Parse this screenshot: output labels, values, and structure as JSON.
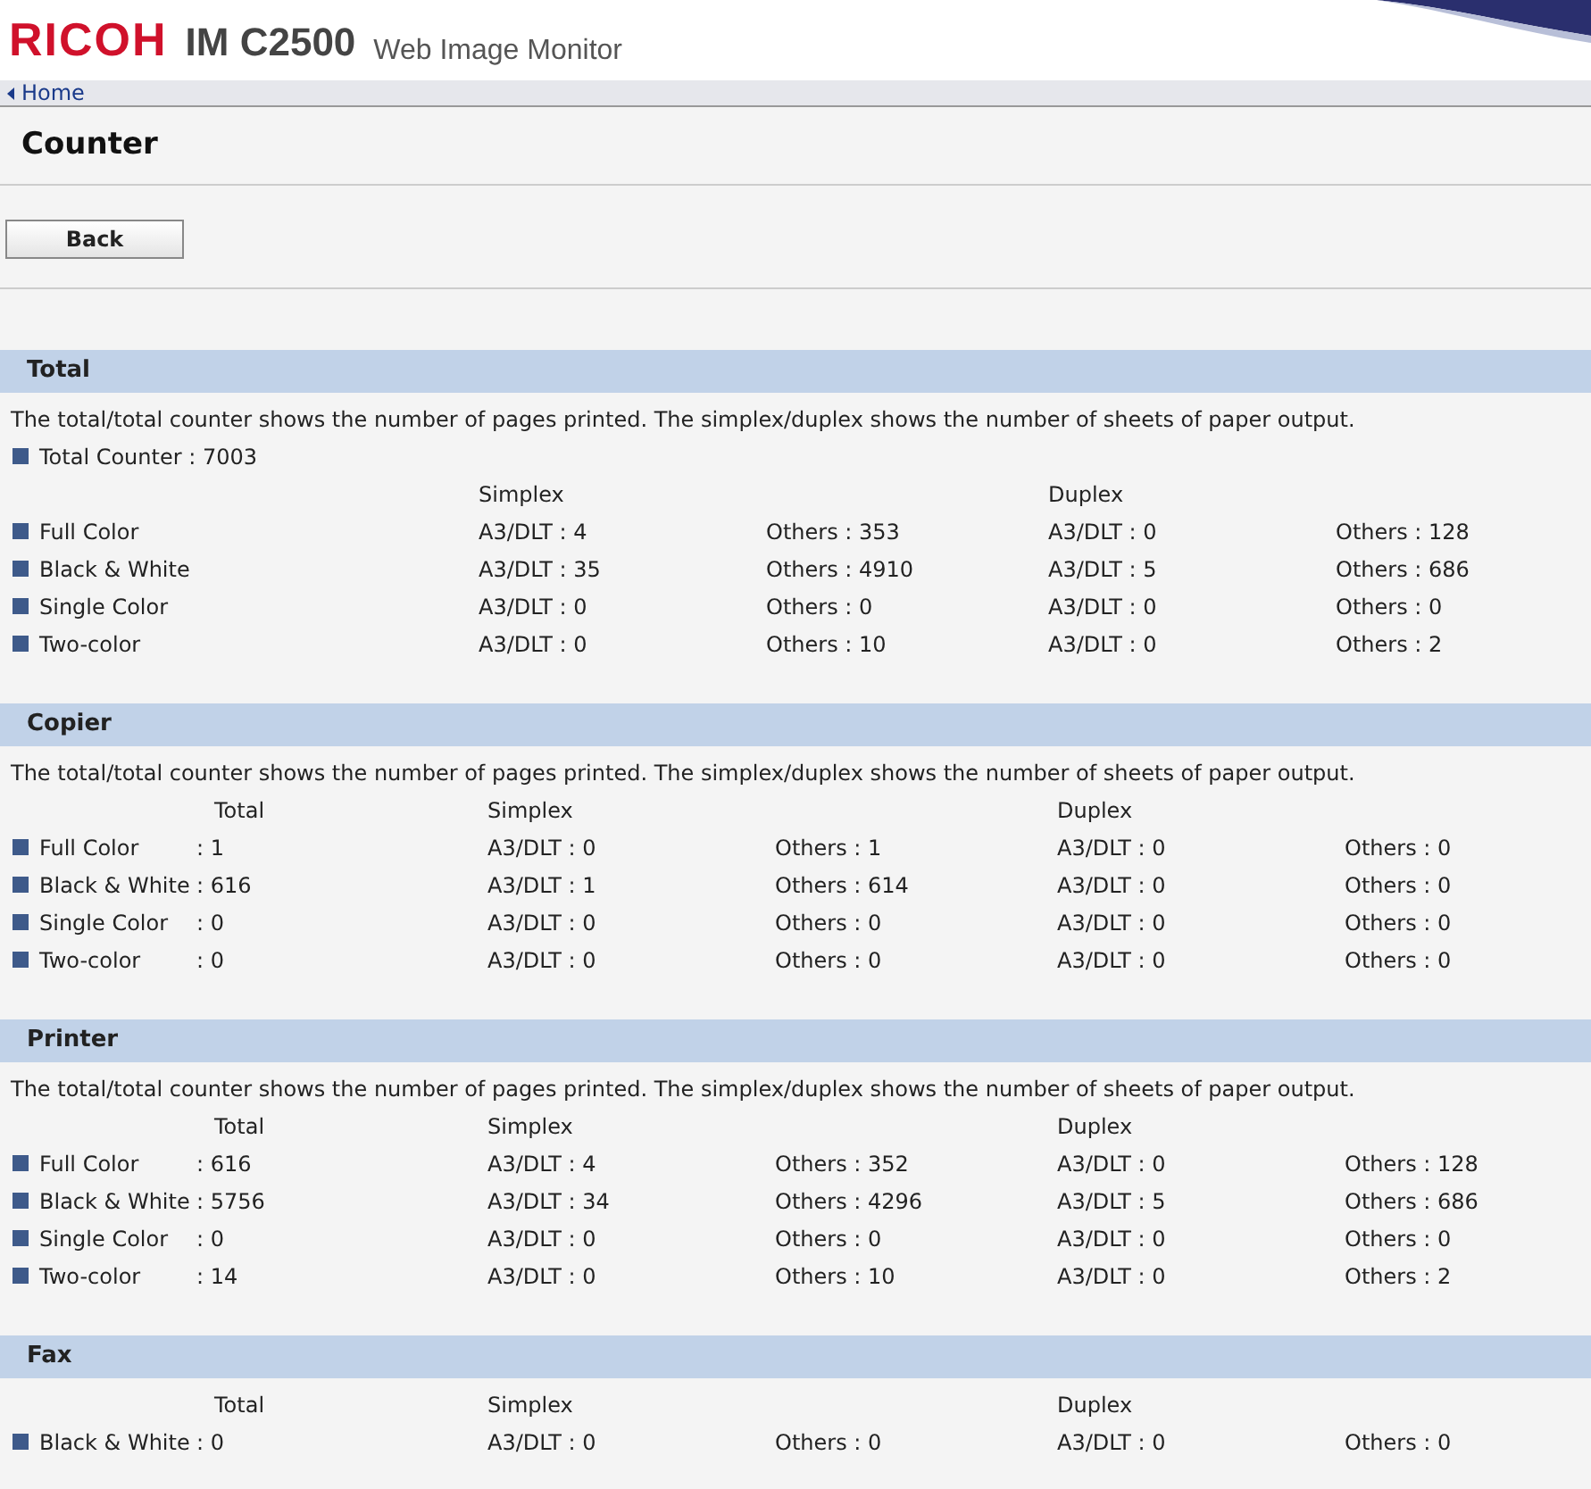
{
  "header": {
    "logo": "RICOH",
    "model": "IM C2500",
    "product": "Web Image Monitor"
  },
  "nav": {
    "home_link": "Home"
  },
  "page_title": "Counter",
  "back_button": "Back",
  "sections": [
    {
      "kind": "simplex_duplex",
      "title": "Total",
      "description": "The total/total counter shows the number of pages printed. The simplex/duplex shows the number of sheets of paper output.",
      "total_counter": "Total Counter : 7003",
      "headers": {
        "simplex": "Simplex",
        "duplex": "Duplex"
      },
      "rows": [
        {
          "label": "Full Color",
          "simplex_a3": "A3/DLT : 4",
          "simplex_others": "Others : 353",
          "duplex_a3": "A3/DLT : 0",
          "duplex_others": "Others : 128"
        },
        {
          "label": "Black & White",
          "simplex_a3": "A3/DLT : 35",
          "simplex_others": "Others : 4910",
          "duplex_a3": "A3/DLT : 5",
          "duplex_others": "Others : 686"
        },
        {
          "label": "Single Color",
          "simplex_a3": "A3/DLT : 0",
          "simplex_others": "Others : 0",
          "duplex_a3": "A3/DLT : 0",
          "duplex_others": "Others : 0"
        },
        {
          "label": "Two-color",
          "simplex_a3": "A3/DLT : 0",
          "simplex_others": "Others : 10",
          "duplex_a3": "A3/DLT : 0",
          "duplex_others": "Others : 2"
        }
      ]
    },
    {
      "kind": "with_total",
      "title": "Copier",
      "description": "The total/total counter shows the number of pages printed. The simplex/duplex shows the number of sheets of paper output.",
      "headers": {
        "total": "Total",
        "simplex": "Simplex",
        "duplex": "Duplex"
      },
      "rows": [
        {
          "label": "Full Color",
          "total": ": 1",
          "simplex_a3": "A3/DLT : 0",
          "simplex_others": "Others : 1",
          "duplex_a3": "A3/DLT : 0",
          "duplex_others": "Others : 0"
        },
        {
          "label": "Black & White",
          "total": ": 616",
          "simplex_a3": "A3/DLT : 1",
          "simplex_others": "Others : 614",
          "duplex_a3": "A3/DLT : 0",
          "duplex_others": "Others : 0"
        },
        {
          "label": "Single Color",
          "total": ": 0",
          "simplex_a3": "A3/DLT : 0",
          "simplex_others": "Others : 0",
          "duplex_a3": "A3/DLT : 0",
          "duplex_others": "Others : 0"
        },
        {
          "label": "Two-color",
          "total": ": 0",
          "simplex_a3": "A3/DLT : 0",
          "simplex_others": "Others : 0",
          "duplex_a3": "A3/DLT : 0",
          "duplex_others": "Others : 0"
        }
      ]
    },
    {
      "kind": "with_total",
      "title": "Printer",
      "description": "The total/total counter shows the number of pages printed. The simplex/duplex shows the number of sheets of paper output.",
      "headers": {
        "total": "Total",
        "simplex": "Simplex",
        "duplex": "Duplex"
      },
      "rows": [
        {
          "label": "Full Color",
          "total": ": 616",
          "simplex_a3": "A3/DLT : 4",
          "simplex_others": "Others : 352",
          "duplex_a3": "A3/DLT : 0",
          "duplex_others": "Others : 128"
        },
        {
          "label": "Black & White",
          "total": ": 5756",
          "simplex_a3": "A3/DLT : 34",
          "simplex_others": "Others : 4296",
          "duplex_a3": "A3/DLT : 5",
          "duplex_others": "Others : 686"
        },
        {
          "label": "Single Color",
          "total": ": 0",
          "simplex_a3": "A3/DLT : 0",
          "simplex_others": "Others : 0",
          "duplex_a3": "A3/DLT : 0",
          "duplex_others": "Others : 0"
        },
        {
          "label": "Two-color",
          "total": ": 14",
          "simplex_a3": "A3/DLT : 0",
          "simplex_others": "Others : 10",
          "duplex_a3": "A3/DLT : 0",
          "duplex_others": "Others : 2"
        }
      ]
    },
    {
      "kind": "with_total",
      "title": "Fax",
      "headers": {
        "total": "Total",
        "simplex": "Simplex",
        "duplex": "Duplex"
      },
      "rows": [
        {
          "label": "Black & White",
          "total": ": 0",
          "simplex_a3": "A3/DLT : 0",
          "simplex_others": "Others : 0",
          "duplex_a3": "A3/DLT : 0",
          "duplex_others": "Others : 0"
        }
      ]
    }
  ]
}
